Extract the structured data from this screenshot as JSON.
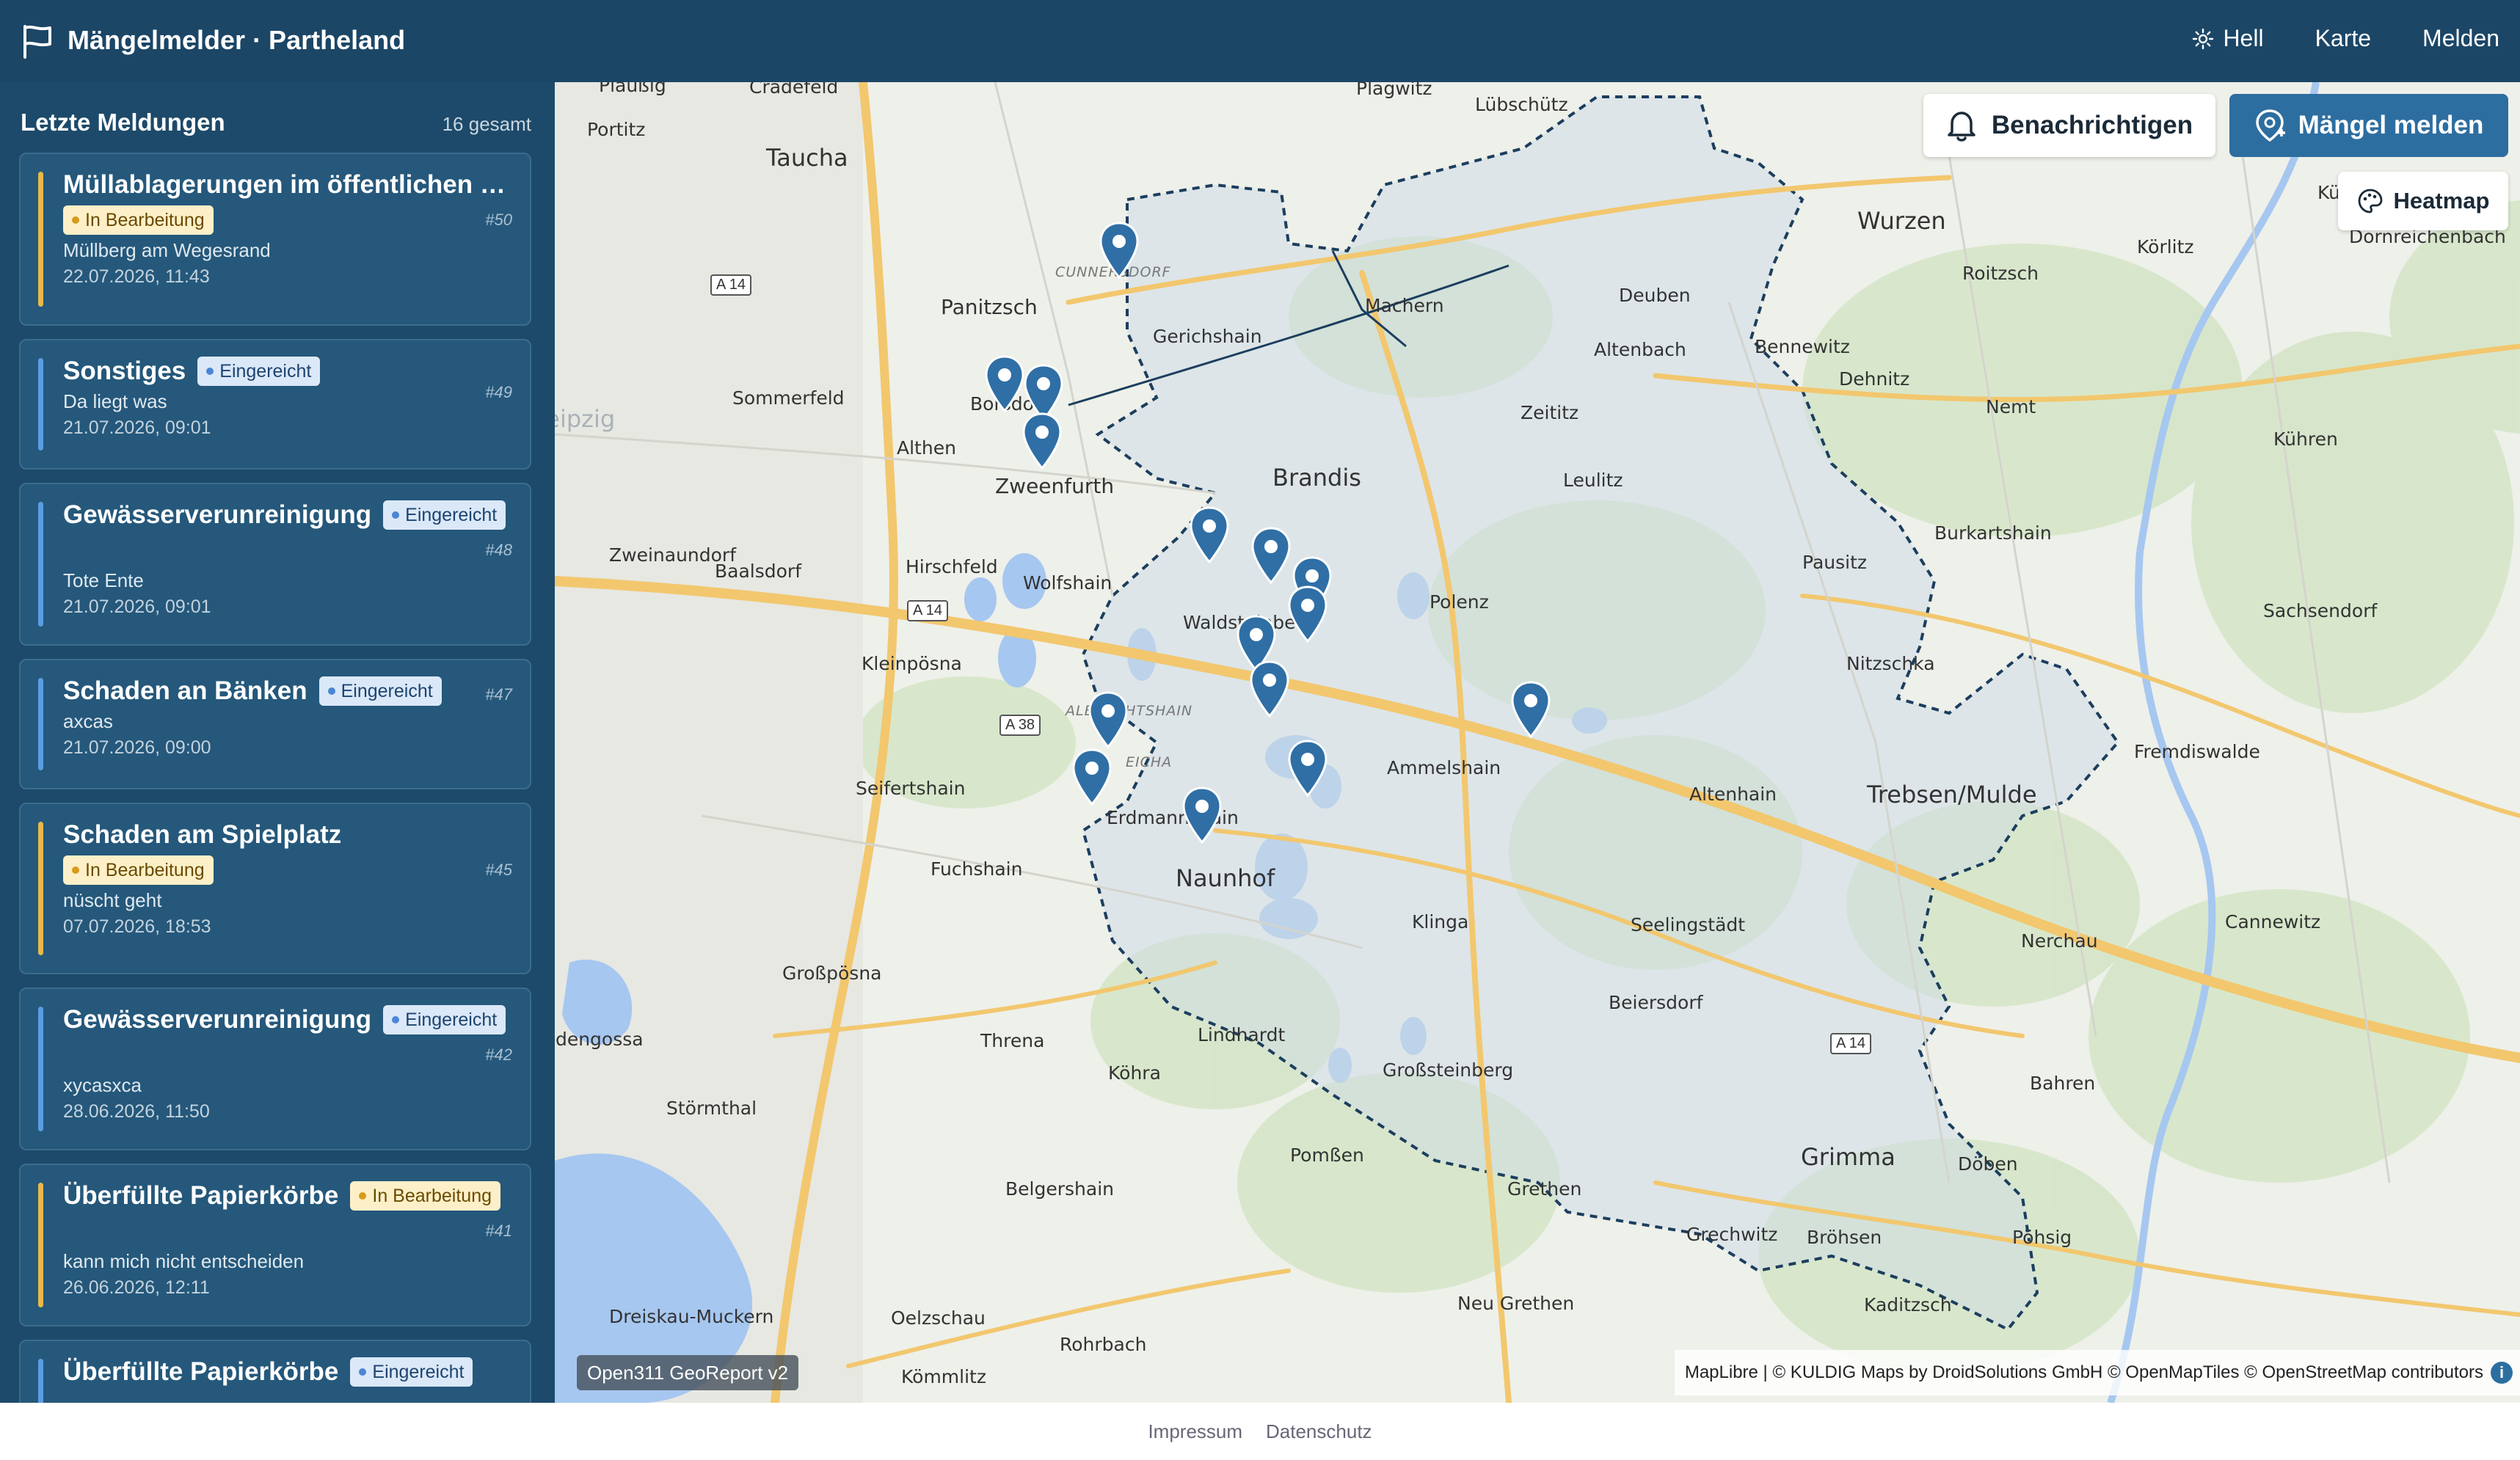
{
  "header": {
    "title": "Mängelmelder · Partheland",
    "nav": {
      "theme": "Hell",
      "map": "Karte",
      "report": "Melden"
    }
  },
  "sidebar": {
    "title": "Letzte Meldungen",
    "count": "16 gesamt",
    "reports": [
      {
        "title": "Müllablagerungen im öffentlichen B...",
        "status": "In Bearbeitung",
        "id": "#50",
        "desc": "Müllberg am Wegesrand",
        "date": "22.07.2026, 11:43"
      },
      {
        "title": "Sonstiges",
        "status": "Eingereicht",
        "id": "#49",
        "desc": "Da liegt was",
        "date": "21.07.2026, 09:01"
      },
      {
        "title": "Gewässerverunreinigung",
        "status": "Eingereicht",
        "id": "#48",
        "desc": "Tote Ente",
        "date": "21.07.2026, 09:01"
      },
      {
        "title": "Schaden an Bänken",
        "status": "Eingereicht",
        "id": "#47",
        "desc": "axcas",
        "date": "21.07.2026, 09:00"
      },
      {
        "title": "Schaden am Spielplatz",
        "status": "In Bearbeitung",
        "id": "#45",
        "desc": "nüscht geht",
        "date": "07.07.2026, 18:53"
      },
      {
        "title": "Gewässerverunreinigung",
        "status": "Eingereicht",
        "id": "#42",
        "desc": "xycasxca",
        "date": "28.06.2026, 11:50"
      },
      {
        "title": "Überfüllte Papierkörbe",
        "status": "In Bearbeitung",
        "id": "#41",
        "desc": "kann mich nicht entscheiden",
        "date": "26.06.2026, 12:11"
      },
      {
        "title": "Überfüllte Papierkörbe",
        "status": "Eingereicht",
        "id": "",
        "desc": "",
        "date": ""
      }
    ]
  },
  "map": {
    "buttons": {
      "notify": "Benachrichtigen",
      "report": "Mängel melden",
      "heatmap": "Heatmap"
    },
    "api_chip": "Open311 GeoReport v2",
    "attribution": "MapLibre | © KULDIG Maps by DroidSolutions GmbH © OpenMapTiles © OpenStreetMap contributors",
    "places": {
      "plausig": "Plaußig",
      "cradefeld": "Cradefeld",
      "plagwitz": "Plagwitz",
      "luebschuetz": "Lübschütz",
      "portitz": "Portitz",
      "taucha": "Taucha",
      "wurzen": "Wurzen",
      "kuehnitzsch": "Kühnitzsch",
      "panitzsch": "Panitzsch",
      "machern": "Machern",
      "gerichshain": "Gerichshain",
      "deuben": "Deuben",
      "bennewitz": "Bennewitz",
      "roitzsch": "Roitzsch",
      "koerlitz": "Körlitz",
      "sommerfeld": "Sommerfeld",
      "borsdorf": "Borsdorf",
      "althen": "Althen",
      "altenbach": "Altenbach",
      "dehnitz": "Dehnitz",
      "leipzig": "Leipzig",
      "zweenfurth": "Zweenfurth",
      "brandis": "Brandis",
      "zeititz": "Zeititz",
      "nemt": "Nemt",
      "kuehren": "Kühren",
      "leulitz": "Leulitz",
      "zweinaundorf": "Zweinaundorf",
      "baalsdorf": "Baalsdorf",
      "hirschfeld": "Hirschfeld",
      "wolfshain": "Wolfshain",
      "burkartshain": "Burkartshain",
      "pausitz": "Pausitz",
      "waldsteinberg": "Waldsteinberg",
      "polenz": "Polenz",
      "sachsendorf": "Sachsendorf",
      "kleinpoesna": "Kleinpösna",
      "nitzschka": "Nitzschka",
      "ammelshain": "Ammelshain",
      "fremdiswalde": "Fremdiswalde",
      "seifertshain": "Seifertshain",
      "altenhain": "Altenhain",
      "trebsen": "Trebsen/Mulde",
      "erdmannshain": "Erdmannshain",
      "fuchshain": "Fuchshain",
      "naunhof": "Naunhof",
      "klinga": "Klinga",
      "seelingstaedt": "Seelingstädt",
      "nerchau": "Nerchau",
      "cannewitz": "Cannewitz",
      "grosspoesna": "Großpösna",
      "beiersdorf": "Beiersdorf",
      "threna": "Threna",
      "lindhardt": "Lindhardt",
      "koehra": "Köhra",
      "grosssteinberg": "Großsteinberg",
      "bahren": "Bahren",
      "stoermthal": "Störmthal",
      "doeben": "Döben",
      "grimma": "Grimma",
      "pomssen": "Pomßen",
      "belgershain": "Belgershain",
      "grethen": "Grethen",
      "grechwitz": "Grechwitz",
      "broehsen": "Bröhsen",
      "poehsig": "Pöhsig",
      "kaditzsch": "Kaditzsch",
      "dreiskau": "Dreiskau-Muckern",
      "oelzschau": "Oelzschau",
      "neugrethen": "Neu Grethen",
      "rohrbach": "Rohrbach",
      "koemmlitz": "Kömmlitz",
      "eicha": "EICHA",
      "albrechtshain": "ALBRECHTSHAIN",
      "cunnersdorf": "CUNNERSDORF",
      "dornreichenbach": "Dornreichenbach",
      "idengossa": "idengossa"
    },
    "highways": {
      "a14a": "A 14",
      "a14b": "A 14",
      "a38": "A 38",
      "a14c": "A 14"
    }
  },
  "footer": {
    "impressum": "Impressum",
    "datenschutz": "Datenschutz"
  }
}
